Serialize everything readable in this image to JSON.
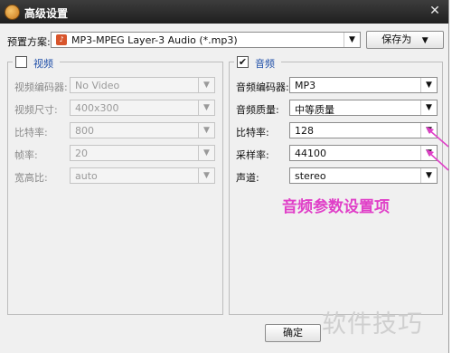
{
  "window": {
    "title": "高级设置",
    "close_glyph": "✕"
  },
  "preset": {
    "label": "预置方案:",
    "value": "MP3-MPEG Layer-3 Audio (*.mp3)",
    "save_as": "保存为",
    "chevron": "▼"
  },
  "video": {
    "group_label": "视频",
    "checked": false,
    "rows": [
      {
        "label": "视频编码器:",
        "value": "No Video"
      },
      {
        "label": "视频尺寸:",
        "value": "400x300"
      },
      {
        "label": "比特率:",
        "value": "800"
      },
      {
        "label": "帧率:",
        "value": "20"
      },
      {
        "label": "宽高比:",
        "value": "auto"
      }
    ]
  },
  "audio": {
    "group_label": "音频",
    "checked": true,
    "check_glyph": "✔",
    "rows": [
      {
        "label": "音频编码器:",
        "value": "MP3"
      },
      {
        "label": "音频质量:",
        "value": "中等质量"
      },
      {
        "label": "比特率:",
        "value": "128"
      },
      {
        "label": "采样率:",
        "value": "44100"
      },
      {
        "label": "声道:",
        "value": "stereo"
      }
    ]
  },
  "footer": {
    "ok": "确定"
  },
  "annotation": {
    "text": "音频参数设置项",
    "color": "#e040c8"
  },
  "watermark": "软件技巧",
  "icons": {
    "app": "app-logo-icon",
    "mp3": "mp3-file-icon",
    "dropdown": "chevron-down-icon"
  }
}
